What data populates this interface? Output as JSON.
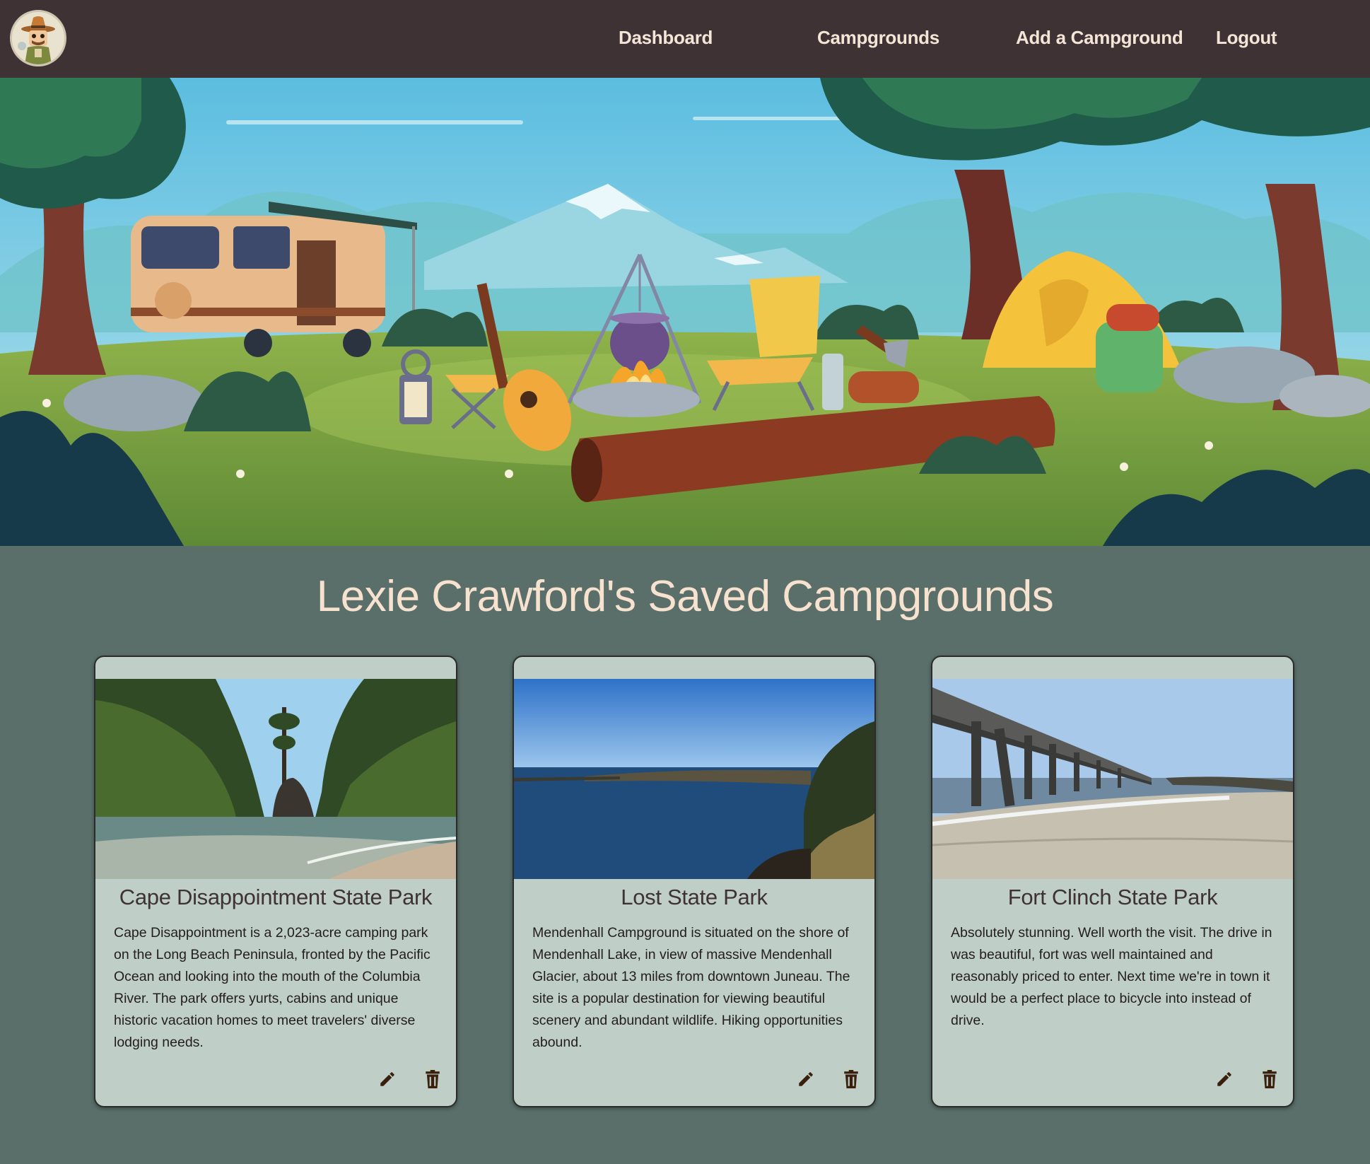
{
  "nav": {
    "logo_icon": "ranger-mascot-icon",
    "links": [
      {
        "label": "Dashboard"
      },
      {
        "label": "Campgrounds"
      },
      {
        "label": "Add a Campground"
      },
      {
        "label": "Logout"
      }
    ]
  },
  "hero": {
    "image": "camping-scene-illustration"
  },
  "page": {
    "title": "Lexie Crawford's Saved Campgrounds"
  },
  "cards": [
    {
      "name": "Cape Disappointment State Park",
      "description": "Cape Disappointment is a 2,023-acre camping park on the Long Beach Peninsula, fronted by the Pacific Ocean and looking into the mouth of the Columbia River. The park offers yurts, cabins and unique historic vacation homes to meet travelers' diverse lodging needs.",
      "edit_icon": "pencil-icon",
      "delete_icon": "trash-icon"
    },
    {
      "name": "Lost State Park",
      "description": "Mendenhall Campground is situated on the shore of Mendenhall Lake, in view of massive Mendenhall Glacier, about 13 miles from downtown Juneau. The site is a popular destination for viewing beautiful scenery and abundant wildlife. Hiking opportunities abound.",
      "edit_icon": "pencil-icon",
      "delete_icon": "trash-icon"
    },
    {
      "name": "Fort Clinch State Park",
      "description": "Absolutely stunning. Well worth the visit. The drive in was beautiful, fort was well maintained and reasonably priced to enter. Next time we're in town it would be a perfect place to bicycle into instead of drive.",
      "edit_icon": "pencil-icon",
      "delete_icon": "trash-icon"
    }
  ],
  "colors": {
    "navbar": "#3f3235",
    "background": "#5a6f6a",
    "card": "#bfcfc8",
    "title": "#f6e2cf",
    "icon": "#3a1f0c"
  }
}
